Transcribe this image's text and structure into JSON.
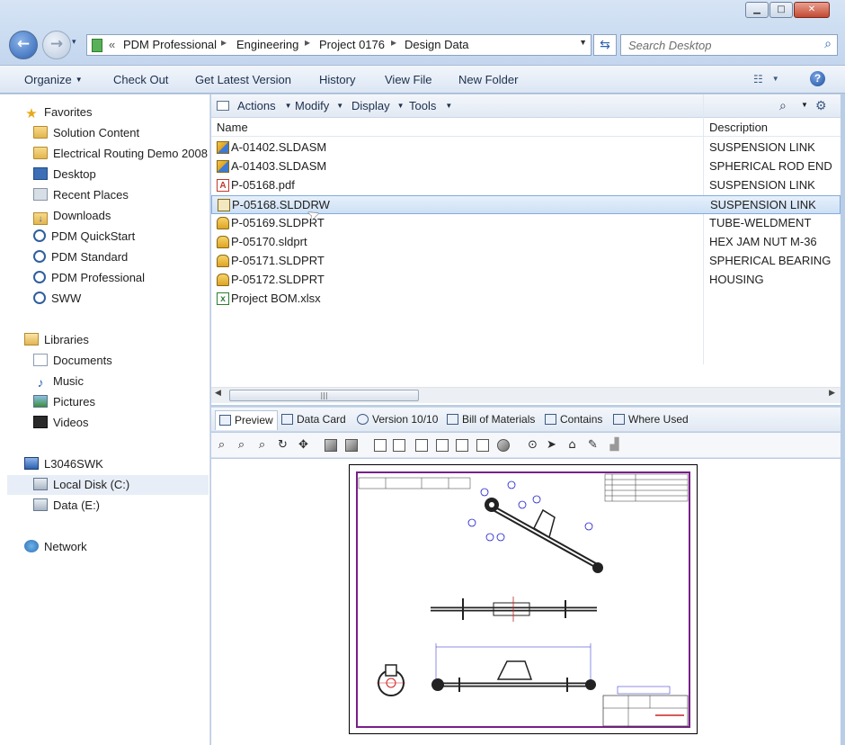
{
  "window": {
    "minimize": "▁",
    "maximize": "□",
    "close": "✕"
  },
  "nav": {
    "back": "←",
    "forward": "→",
    "history": "▾"
  },
  "address": {
    "chevron": "«",
    "crumbs": [
      "PDM Professional",
      "Engineering",
      "Project 0176",
      "Design Data"
    ],
    "separator": "▸"
  },
  "search": {
    "placeholder": "Search Desktop"
  },
  "commandbar": {
    "organize": "Organize",
    "check_out": "Check Out",
    "get_latest": "Get Latest Version",
    "history": "History",
    "view_file": "View File",
    "new_folder": "New Folder",
    "help": "?"
  },
  "sidebar": {
    "favorites": {
      "title": "Favorites",
      "items": [
        "Solution Content",
        "Electrical Routing Demo 2008",
        "Desktop",
        "Recent Places",
        "Downloads",
        "PDM QuickStart",
        "PDM Standard",
        "PDM Professional",
        "SWW"
      ]
    },
    "libraries": {
      "title": "Libraries",
      "items": [
        "Documents",
        "Music",
        "Pictures",
        "Videos"
      ]
    },
    "computer": {
      "title": "L3046SWK",
      "items": [
        "Local Disk (C:)",
        "Data (E:)"
      ]
    },
    "network": {
      "title": "Network"
    }
  },
  "pdm_toolbar": {
    "actions": "Actions",
    "modify": "Modify",
    "display": "Display",
    "tools": "Tools"
  },
  "file_list": {
    "columns": {
      "name": "Name",
      "description": "Description"
    },
    "rows": [
      {
        "name": "A-01402.SLDASM",
        "description": "SUSPENSION LINK",
        "icon": "assembly-icon"
      },
      {
        "name": "A-01403.SLDASM",
        "description": "SPHERICAL ROD END",
        "icon": "assembly-icon"
      },
      {
        "name": "P-05168.pdf",
        "description": "SUSPENSION LINK",
        "icon": "pdf-icon"
      },
      {
        "name": "P-05168.SLDDRW",
        "description": "SUSPENSION LINK",
        "icon": "drawing-icon",
        "selected": true
      },
      {
        "name": "P-05169.SLDPRT",
        "description": "TUBE-WELDMENT",
        "icon": "part-icon"
      },
      {
        "name": "P-05170.sldprt",
        "description": "HEX JAM NUT M-36",
        "icon": "part-icon"
      },
      {
        "name": "P-05171.SLDPRT",
        "description": "SPHERICAL BEARING",
        "icon": "part-icon"
      },
      {
        "name": "P-05172.SLDPRT",
        "description": "HOUSING",
        "icon": "part-icon"
      },
      {
        "name": "Project BOM.xlsx",
        "description": "",
        "icon": "excel-icon"
      }
    ]
  },
  "tabs": [
    "Preview",
    "Data Card",
    "Version 10/10",
    "Bill of Materials",
    "Contains",
    "Where Used"
  ],
  "colors": {
    "drawing_border": "#7a1f8a",
    "part_lines": "#1a1acc",
    "selection": "#cde0f5"
  }
}
